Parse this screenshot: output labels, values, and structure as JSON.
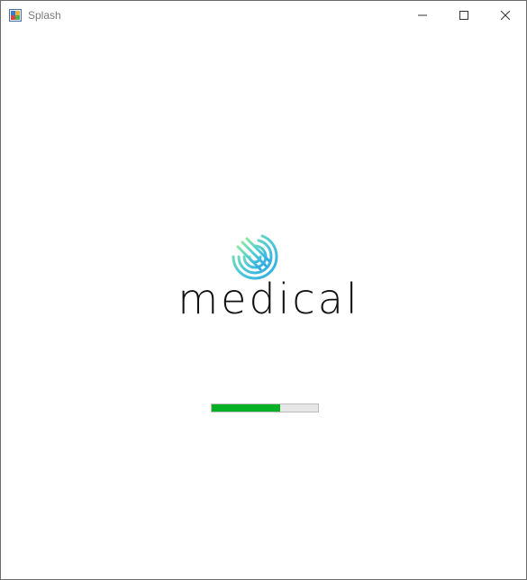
{
  "window": {
    "title": "Splash",
    "icon": "app-window-icon"
  },
  "titlebar_buttons": {
    "minimize": "minimize-icon",
    "maximize": "maximize-icon",
    "close": "close-icon"
  },
  "splash": {
    "brand_text": "medical",
    "logo": "fingerprint-logo-icon",
    "progress": 0.64,
    "progress_color": "#06b025",
    "logo_colors": [
      "#7ee3a0",
      "#4fc9d6",
      "#2fb1e4"
    ]
  }
}
